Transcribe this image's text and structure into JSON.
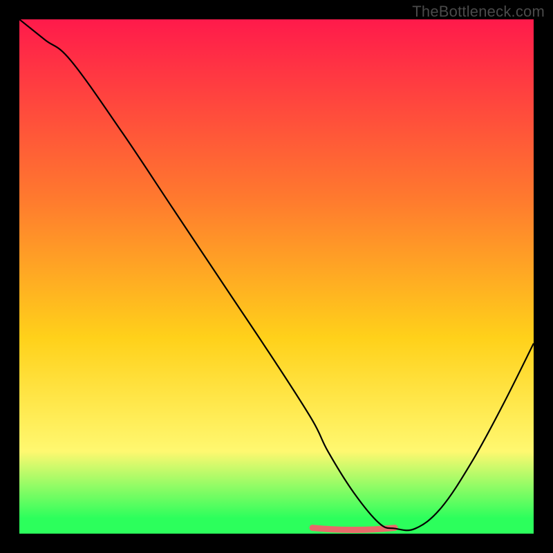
{
  "watermark": "TheBottleneck.com",
  "colors": {
    "bg": "#000000",
    "curve": "#000000",
    "accent": "#e86a6a",
    "grad_top": "#ff1a4b",
    "grad_mid1": "#ff7a2e",
    "grad_mid2": "#ffd11a",
    "grad_mid3": "#fff870",
    "grad_bottom": "#2cff5c"
  },
  "chart_data": {
    "type": "line",
    "title": "",
    "xlabel": "",
    "ylabel": "",
    "xlim": [
      0,
      100
    ],
    "ylim": [
      0,
      100
    ],
    "series": [
      {
        "name": "bottleneck-curve",
        "x": [
          0,
          5,
          10,
          20,
          30,
          40,
          50,
          57,
          60,
          65,
          70,
          73,
          77,
          82,
          88,
          94,
          100
        ],
        "values": [
          100,
          96,
          92,
          78,
          63,
          48,
          33,
          22,
          16,
          8,
          2,
          1,
          1,
          5,
          14,
          25,
          37
        ]
      }
    ],
    "accent_band": {
      "x_start": 57,
      "x_end": 73,
      "y": 1
    },
    "gradient_stops": [
      {
        "pos": 0,
        "color": "#ff1a4b"
      },
      {
        "pos": 35,
        "color": "#ff7a2e"
      },
      {
        "pos": 62,
        "color": "#ffd11a"
      },
      {
        "pos": 84,
        "color": "#fff870"
      },
      {
        "pos": 97,
        "color": "#2cff5c"
      },
      {
        "pos": 100,
        "color": "#2cff5c"
      }
    ]
  }
}
